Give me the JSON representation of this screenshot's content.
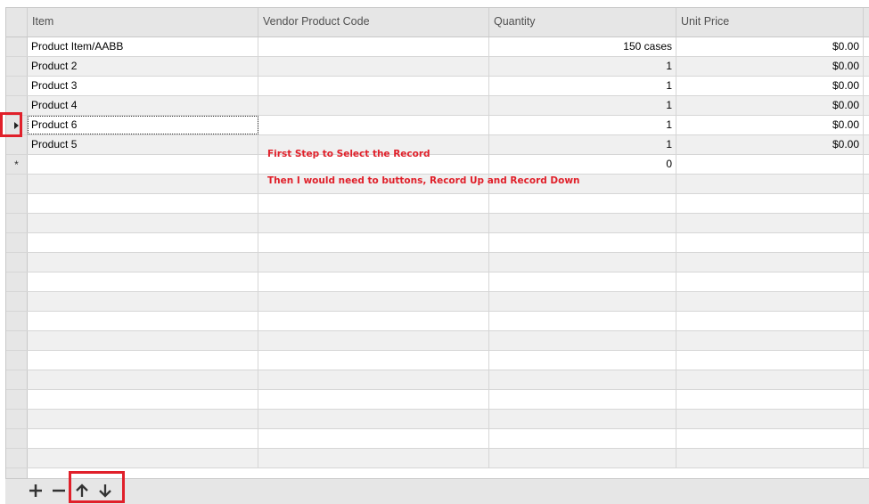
{
  "columns": [
    {
      "id": "item",
      "label": "Item"
    },
    {
      "id": "vendor",
      "label": "Vendor Product Code"
    },
    {
      "id": "quantity",
      "label": "Quantity"
    },
    {
      "id": "unit_price",
      "label": "Unit Price"
    }
  ],
  "rows": [
    {
      "item": "Product Item/AABB",
      "vendor": "",
      "quantity": "150 cases",
      "unit_price": "$0.00"
    },
    {
      "item": "Product 2",
      "vendor": "",
      "quantity": "1",
      "unit_price": "$0.00"
    },
    {
      "item": "Product 3",
      "vendor": "",
      "quantity": "1",
      "unit_price": "$0.00"
    },
    {
      "item": "Product 4",
      "vendor": "",
      "quantity": "1",
      "unit_price": "$0.00"
    },
    {
      "item": "Product 6",
      "vendor": "",
      "quantity": "1",
      "unit_price": "$0.00",
      "selected": true
    },
    {
      "item": "Product 5",
      "vendor": "",
      "quantity": "1",
      "unit_price": "$0.00"
    }
  ],
  "new_row": {
    "marker": "*",
    "quantity": "0"
  },
  "annotations": {
    "line1": "First Step to Select the Record",
    "line2": "Then I would need to buttons, Record Up and Record Down"
  },
  "toolbar": {
    "add_icon": "plus-icon",
    "remove_icon": "minus-icon",
    "up_icon": "arrow-up-icon",
    "down_icon": "arrow-down-icon"
  },
  "colors": {
    "highlight": "#e0202a",
    "header_bg": "#e6e6e6",
    "alt_row": "#f0f0f0"
  }
}
